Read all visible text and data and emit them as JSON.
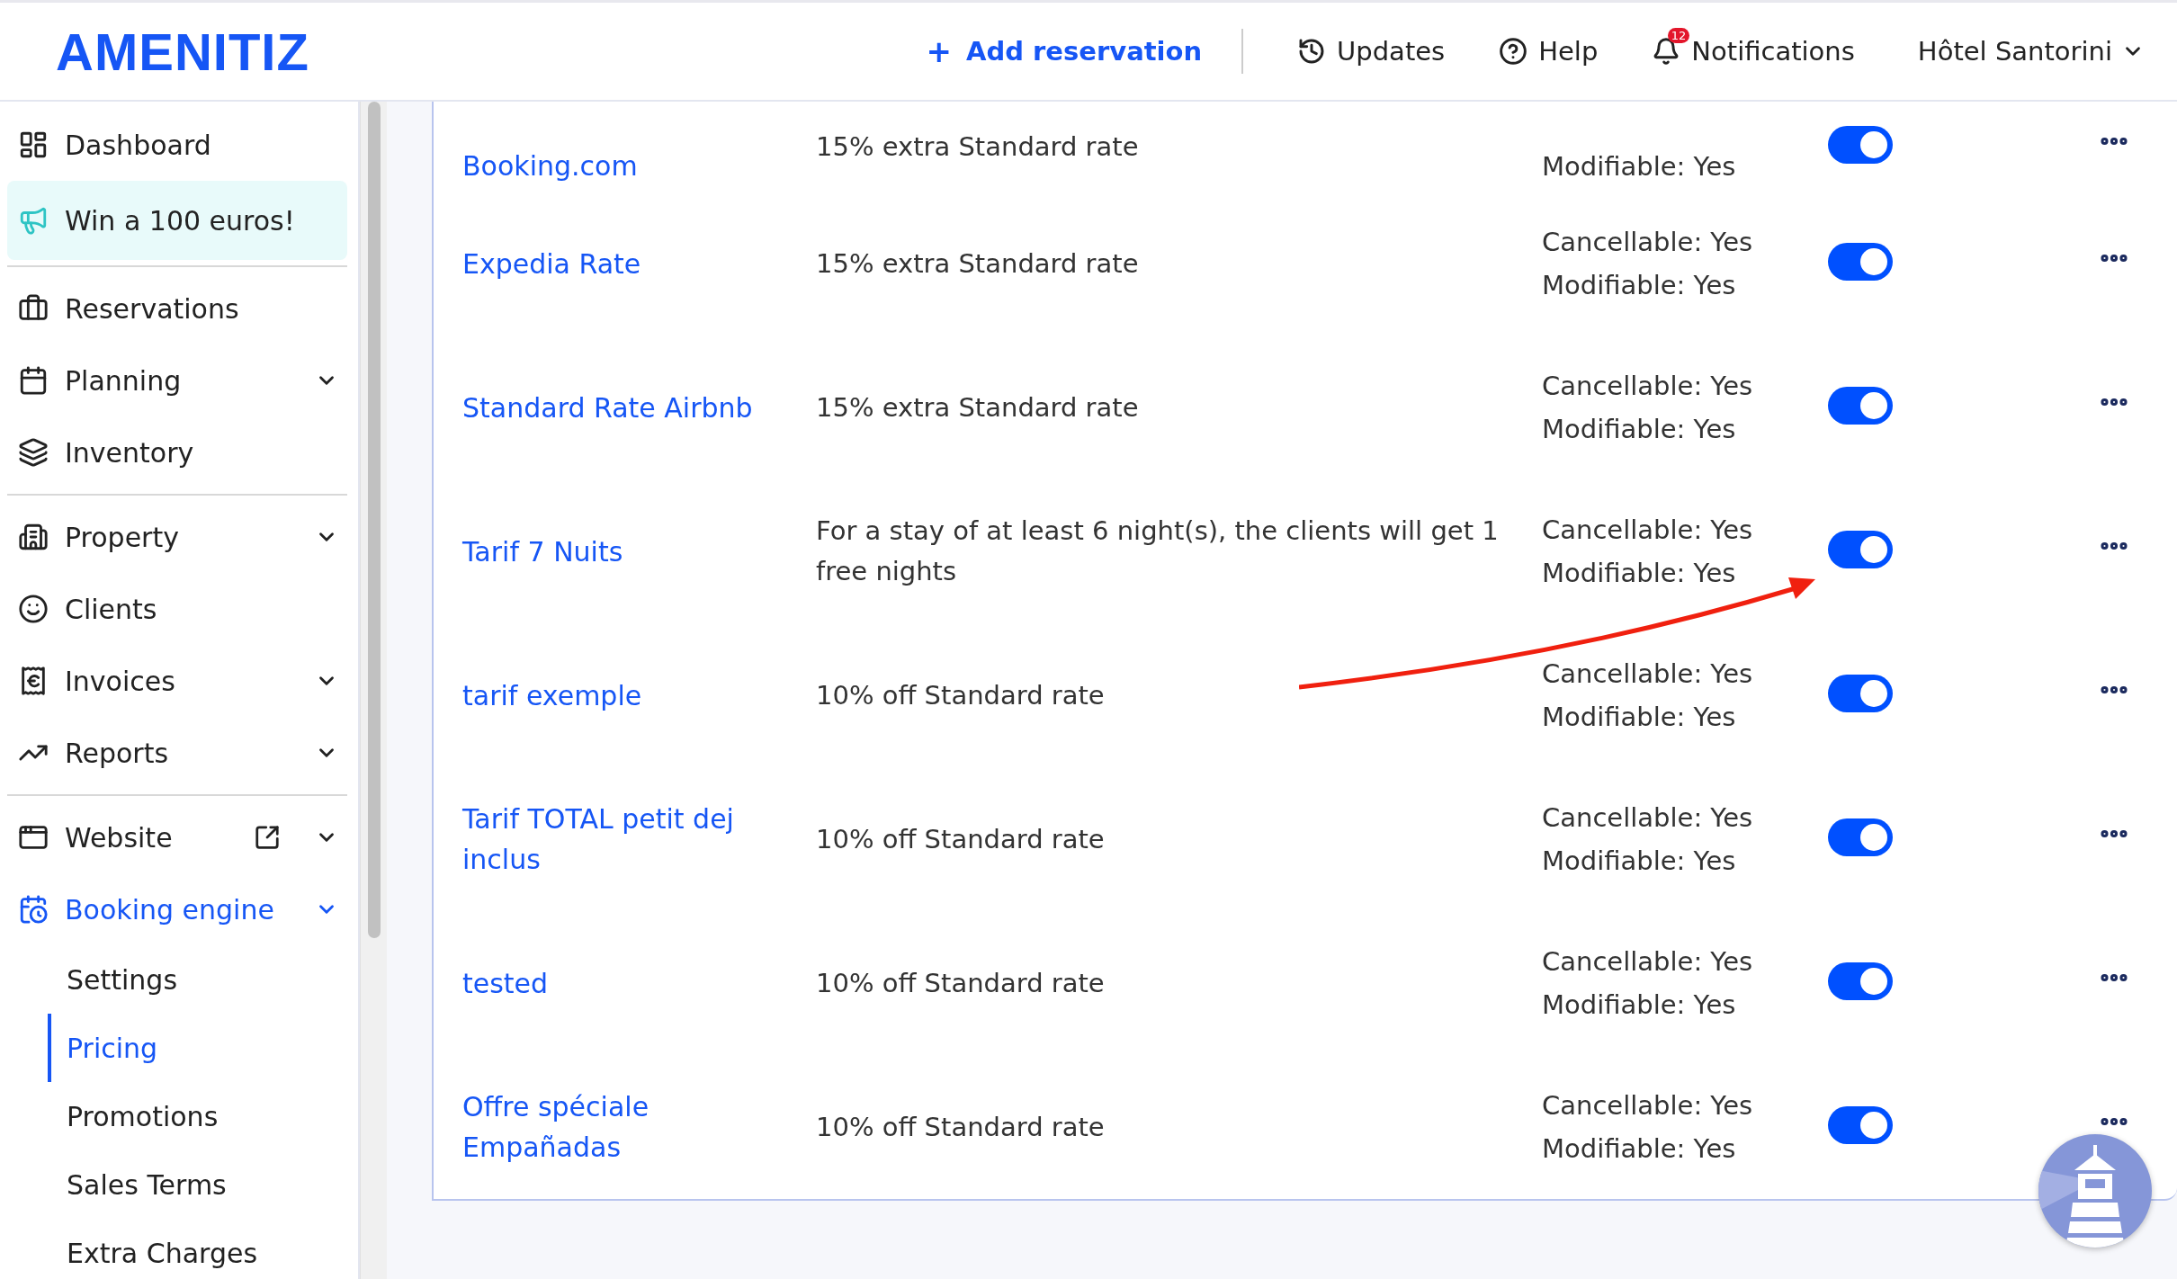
{
  "header": {
    "logo": "AMENITIZ",
    "add_button": {
      "icon": "+",
      "label": "Add reservation"
    },
    "links": [
      {
        "label": "Updates"
      },
      {
        "label": "Help"
      },
      {
        "label": "Notifications",
        "badge": "12"
      }
    ],
    "hotel": "Hôtel Santorini"
  },
  "sidebar": {
    "groups": [
      [
        {
          "label": "Dashboard",
          "selected": false,
          "highlighted": false,
          "chevron": false,
          "external": false
        },
        {
          "label": "Win a 100 euros!",
          "selected": false,
          "highlighted": true,
          "chevron": false,
          "external": false
        }
      ],
      [
        {
          "label": "Reservations",
          "selected": false,
          "highlighted": false,
          "chevron": false,
          "external": false
        },
        {
          "label": "Planning",
          "selected": false,
          "highlighted": false,
          "chevron": true,
          "external": false
        },
        {
          "label": "Inventory",
          "selected": false,
          "highlighted": false,
          "chevron": false,
          "external": false
        }
      ],
      [
        {
          "label": "Property",
          "selected": false,
          "highlighted": false,
          "chevron": true,
          "external": false
        },
        {
          "label": "Clients",
          "selected": false,
          "highlighted": false,
          "chevron": false,
          "external": false
        },
        {
          "label": "Invoices",
          "selected": false,
          "highlighted": false,
          "chevron": true,
          "external": false
        },
        {
          "label": "Reports",
          "selected": false,
          "highlighted": false,
          "chevron": true,
          "external": false
        }
      ],
      [
        {
          "label": "Website",
          "selected": false,
          "highlighted": false,
          "chevron": true,
          "external": true
        },
        {
          "label": "Booking engine",
          "selected": true,
          "highlighted": false,
          "chevron": true,
          "external": false,
          "children": [
            {
              "label": "Settings",
              "selected": false
            },
            {
              "label": "Pricing",
              "selected": true
            },
            {
              "label": "Promotions",
              "selected": false
            },
            {
              "label": "Sales Terms",
              "selected": false
            },
            {
              "label": "Extra Charges",
              "selected": false
            }
          ]
        }
      ]
    ]
  },
  "rates": [
    {
      "name": "Booking.com",
      "description": "15% extra Standard rate",
      "conditions": [
        "Modifiable: Yes"
      ],
      "on": true
    },
    {
      "name": "Expedia Rate",
      "description": "15% extra Standard rate",
      "conditions": [
        "Cancellable: Yes",
        "Modifiable: Yes"
      ],
      "on": true
    },
    {
      "name": "Standard Rate Airbnb",
      "description": "15% extra Standard rate",
      "conditions": [
        "Cancellable: Yes",
        "Modifiable: Yes"
      ],
      "on": true
    },
    {
      "name": "Tarif 7 Nuits",
      "description": "For a stay of at least 6 night(s), the clients will get 1 free nights",
      "conditions": [
        "Cancellable: Yes",
        "Modifiable: Yes"
      ],
      "on": true
    },
    {
      "name": "tarif exemple",
      "description": "10% off Standard rate",
      "conditions": [
        "Cancellable: Yes",
        "Modifiable: Yes"
      ],
      "on": true
    },
    {
      "name": "Tarif TOTAL petit dej inclus",
      "description": "10% off Standard rate",
      "conditions": [
        "Cancellable: Yes",
        "Modifiable: Yes"
      ],
      "on": true
    },
    {
      "name": "tested",
      "description": "10% off Standard rate",
      "conditions": [
        "Cancellable: Yes",
        "Modifiable: Yes"
      ],
      "on": true
    },
    {
      "name": "Offre spéciale Empañadas",
      "description": "10% off Standard rate",
      "conditions": [
        "Cancellable: Yes",
        "Modifiable: Yes"
      ],
      "on": true
    }
  ]
}
